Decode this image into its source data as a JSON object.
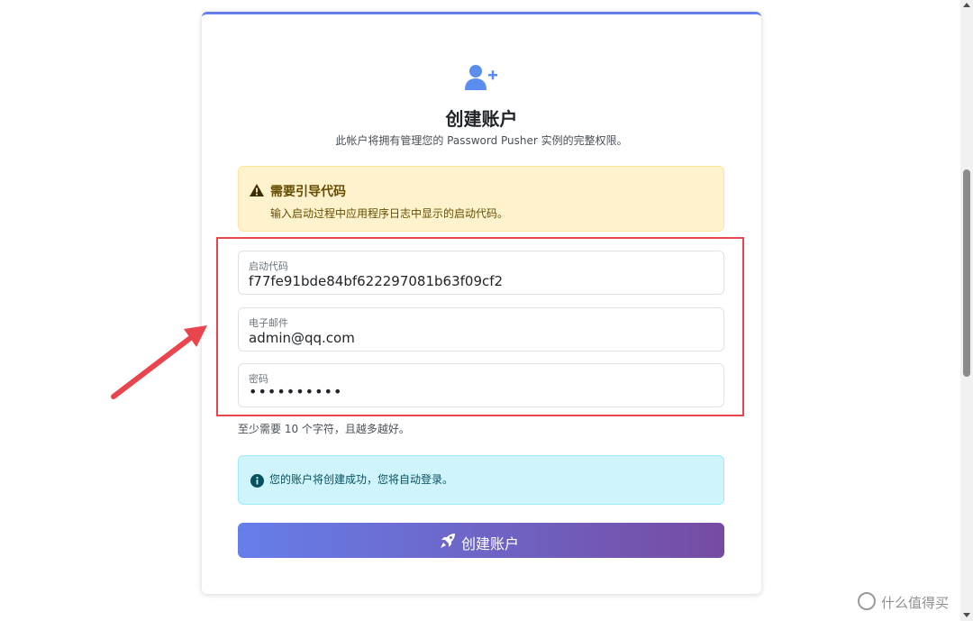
{
  "header": {
    "title": "创建账户",
    "subtitle": "此帐户将拥有管理您的 Password Pusher 实例的完整权限。"
  },
  "warning": {
    "title": "需要引导代码",
    "text": "输入启动过程中应用程序日志中显示的启动代码。"
  },
  "fields": [
    {
      "label": "启动代码",
      "value": "f77fe91bde84bf622297081b63f09cf2"
    },
    {
      "label": "电子邮件",
      "value": "admin@qq.com"
    },
    {
      "label": "密码",
      "value": "••••••••••"
    }
  ],
  "hint": "至少需要 10 个字符，且越多越好。",
  "info": {
    "text": "您的账户将创建成功，您将自动登录。"
  },
  "submit_label": "创建账户",
  "watermark": "什么值得买",
  "colors": {
    "accent_start": "#667eea",
    "accent_end": "#764ba2",
    "warning_bg": "#fff3cd",
    "info_bg": "#cff4fc",
    "highlight": "#e8454e"
  },
  "icons": {
    "header": "user-plus-icon",
    "warning": "warning-triangle-icon",
    "info": "info-circle-icon",
    "submit": "rocket-icon"
  }
}
